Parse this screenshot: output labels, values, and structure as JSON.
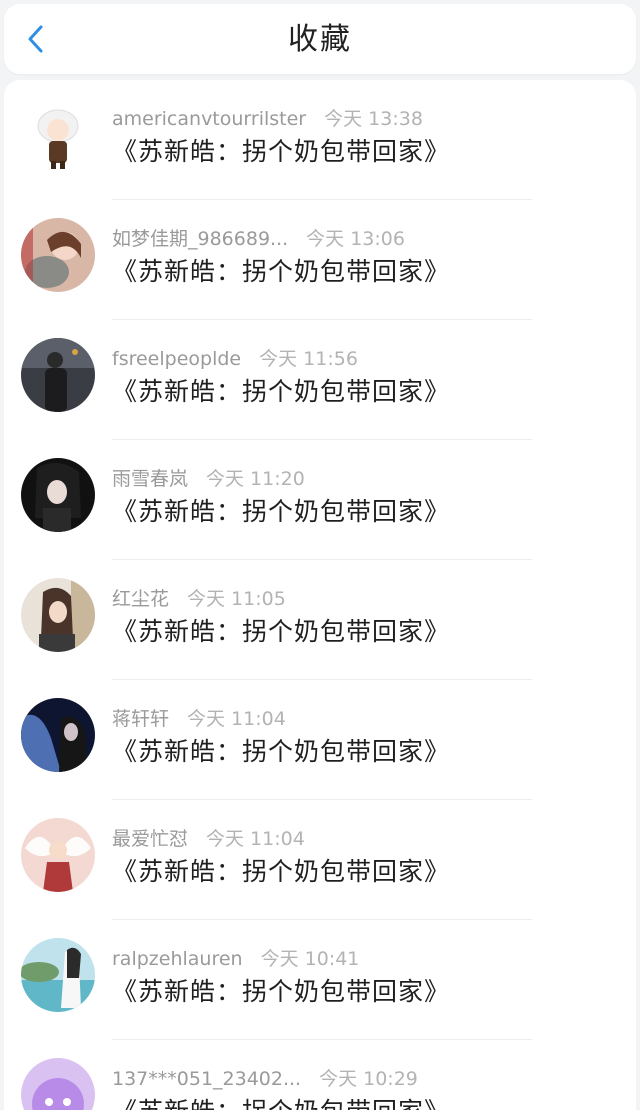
{
  "header": {
    "title": "收藏",
    "back_icon": "chevron-left-icon",
    "accent_color": "#2f8fe6"
  },
  "items": [
    {
      "name": "americanvtourrilster",
      "time": "今天 13:38",
      "desc": "《苏新皓：拐个奶包带回家》"
    },
    {
      "name": "如梦佳期_986689...",
      "time": "今天 13:06",
      "desc": "《苏新皓：拐个奶包带回家》"
    },
    {
      "name": "fsreelpeoplde",
      "time": "今天 11:56",
      "desc": "《苏新皓：拐个奶包带回家》"
    },
    {
      "name": "雨雪春岚",
      "time": "今天 11:20",
      "desc": "《苏新皓：拐个奶包带回家》"
    },
    {
      "name": "红尘花",
      "time": "今天 11:05",
      "desc": "《苏新皓：拐个奶包带回家》"
    },
    {
      "name": "蒋轩轩",
      "time": "今天 11:04",
      "desc": "《苏新皓：拐个奶包带回家》"
    },
    {
      "name": "最爱忙怼",
      "time": "今天 11:04",
      "desc": "《苏新皓：拐个奶包带回家》"
    },
    {
      "name": "ralpzehlauren",
      "time": "今天 10:41",
      "desc": "《苏新皓：拐个奶包带回家》"
    },
    {
      "name": "137***051_23402...",
      "time": "今天 10:29",
      "desc": "《苏新皓：拐个奶包带回家》"
    }
  ]
}
